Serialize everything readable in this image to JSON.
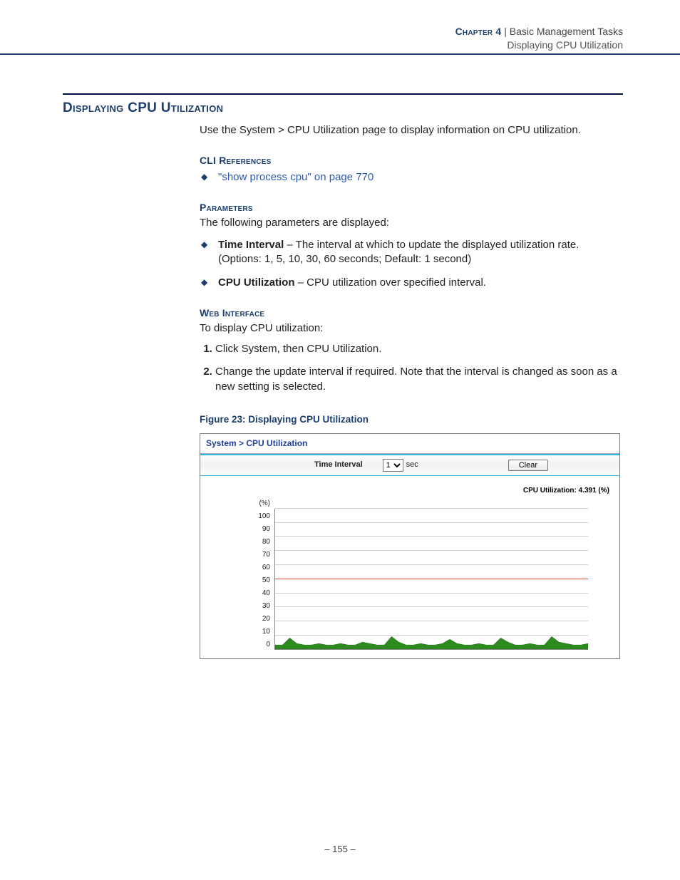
{
  "header": {
    "chapter": "Chapter 4",
    "sep": "  |  ",
    "title": "Basic Management Tasks",
    "subtitle": "Displaying CPU Utilization"
  },
  "section": {
    "title": "Displaying CPU Utilization",
    "intro": "Use the System > CPU Utilization page to display information on CPU utilization."
  },
  "cli": {
    "heading": "CLI References",
    "link_text": "\"show process cpu\" on page 770"
  },
  "parameters": {
    "heading": "Parameters",
    "lead": "The following parameters are displayed:",
    "items": [
      {
        "name": "Time Interval",
        "desc": " – The interval at which to update the displayed utilization rate. (Options: 1, 5, 10, 30, 60 seconds; Default: 1 second)"
      },
      {
        "name": "CPU Utilization",
        "desc": " – CPU utilization over specified interval."
      }
    ]
  },
  "web": {
    "heading": "Web Interface",
    "lead": "To display CPU utilization:",
    "steps": [
      "Click System, then CPU Utilization.",
      "Change the update interval if required. Note that the interval is changed as soon as a new setting is selected."
    ]
  },
  "figure": {
    "caption": "Figure 23:  Displaying CPU Utilization",
    "breadcrumb": "System > CPU Utilization",
    "interval_label": "Time Interval",
    "interval_value": "1",
    "interval_unit": "sec",
    "clear_label": "Clear",
    "cpu_reading_label": "CPU Utilization: 4.391 (%)",
    "yunit": "(%)"
  },
  "footer": {
    "page": "–  155  –"
  },
  "chart_data": {
    "type": "area",
    "title": "CPU Utilization",
    "ylabel": "(%)",
    "ylim": [
      0,
      100
    ],
    "yticks": [
      0,
      10,
      20,
      30,
      40,
      50,
      60,
      70,
      80,
      90,
      100
    ],
    "threshold_line": 50,
    "current_value": 4.391,
    "x": [
      0,
      1,
      2,
      3,
      4,
      5,
      6,
      7,
      8,
      9,
      10,
      11,
      12,
      13,
      14,
      15,
      16,
      17,
      18,
      19,
      20,
      21,
      22,
      23,
      24,
      25,
      26,
      27,
      28,
      29,
      30,
      31,
      32,
      33,
      34,
      35,
      36,
      37,
      38,
      39,
      40,
      41,
      42,
      43
    ],
    "values": [
      3,
      3,
      8,
      4,
      3,
      3,
      4,
      3,
      3,
      4,
      3,
      3,
      5,
      4,
      3,
      3,
      9,
      5,
      3,
      3,
      4,
      3,
      3,
      4,
      7,
      4,
      3,
      3,
      4,
      3,
      3,
      8,
      5,
      3,
      3,
      4,
      3,
      3,
      9,
      5,
      4,
      3,
      3,
      4
    ]
  }
}
